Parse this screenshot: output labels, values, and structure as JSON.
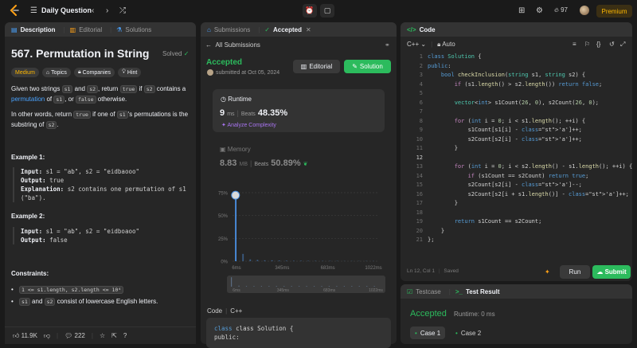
{
  "topnav": {
    "title": "Daily Question",
    "streak_count": "97",
    "premium_label": "Premium"
  },
  "left_panel": {
    "tabs": [
      {
        "label": "Description",
        "icon": "document-icon",
        "active": true
      },
      {
        "label": "Editorial",
        "icon": "book-icon",
        "active": false
      },
      {
        "label": "Solutions",
        "icon": "flask-icon",
        "active": false
      }
    ],
    "title": "567. Permutation in String",
    "solved_label": "Solved",
    "tags": [
      {
        "label": "Medium"
      },
      {
        "label": "Topics"
      },
      {
        "label": "Companies"
      },
      {
        "label": "Hint"
      }
    ],
    "desc": {
      "p1_a": "Given two strings ",
      "p1_s1": "s1",
      "p1_b": " and ",
      "p1_s2": "s2",
      "p1_c": ", return ",
      "p1_true": "true",
      "p1_d": " if ",
      "p1_s2b": "s2",
      "p1_e": " contains a ",
      "p1_link": "permutation",
      "p1_f": " of ",
      "p1_s1b": "s1",
      "p1_g": ", or ",
      "p1_false": "false",
      "p1_h": " otherwise.",
      "p2_a": "In other words, return ",
      "p2_true": "true",
      "p2_b": " if one of ",
      "p2_s1": "s1",
      "p2_c": "'s permutations is the substring of ",
      "p2_s2": "s2",
      "p2_d": "."
    },
    "examples": [
      {
        "title": "Example 1:",
        "input": "s1 = \"ab\", s2 = \"eidbaooo\"",
        "output": "true",
        "explanation": "s2 contains one permutation of s1 (\"ba\")."
      },
      {
        "title": "Example 2:",
        "input": "s1 = \"ab\", s2 = \"eidboaoo\"",
        "output": "false"
      }
    ],
    "labels": {
      "input": "Input:",
      "output": "Output:",
      "explanation": "Explanation:"
    },
    "constraints_title": "Constraints:",
    "constraints": {
      "c1": "1 <= s1.length, s2.length <= 10⁴",
      "c2_s1": "s1",
      "c2_and": " and ",
      "c2_s2": "s2",
      "c2_rest": " consist of lowercase English letters."
    },
    "footer": {
      "likes": "11.9K",
      "comments": "222"
    }
  },
  "middle_panel": {
    "tabs": [
      {
        "label": "Submissions",
        "icon": "tag-icon",
        "active": false
      },
      {
        "label": "Accepted",
        "icon": "check-icon",
        "active": true
      }
    ],
    "back_label": "All Submissions",
    "status": "Accepted",
    "submitted_at": "submitted at Oct 05, 2024",
    "editorial_btn": "Editorial",
    "solution_btn": "Solution",
    "runtime": {
      "label": "Runtime",
      "value": "9",
      "unit": "ms",
      "beats_label": "Beats",
      "beats": "48.35%",
      "analyze": "Analyze Complexity"
    },
    "memory": {
      "label": "Memory",
      "value": "8.83",
      "unit": "MB",
      "beats_label": "Beats",
      "beats": "50.89%"
    },
    "code_label": "Code",
    "code_lang": "C++",
    "code_preview": [
      "class Solution {",
      "public:"
    ]
  },
  "chart_data": {
    "type": "bar",
    "y_ticks": [
      "75%",
      "50%",
      "25%",
      "0%"
    ],
    "x_ticks": [
      "6ms",
      "345ms",
      "683ms",
      "1022ms"
    ],
    "minimap_ticks": [
      "6ms",
      "345ms",
      "683ms",
      "1022ms"
    ],
    "ylim": [
      0,
      75
    ],
    "series": [
      {
        "values": [
          74,
          8,
          2,
          1.5,
          1,
          1,
          0.8,
          0.6,
          0.5,
          0.5,
          0.4,
          0.4,
          0.3,
          0.3,
          0.3,
          0.2,
          0.2,
          0.2,
          0.2,
          0.2
        ]
      }
    ],
    "highlight_index": 0,
    "accent_color": "#4a90e2"
  },
  "right_panel": {
    "tab": "Code",
    "language": "C++",
    "autosave": "Auto",
    "cursor": "Ln 12, Col 1",
    "saved": "Saved",
    "run_btn": "Run",
    "submit_btn": "Submit",
    "code_lines": [
      "class Solution {",
      "public:",
      "    bool checkInclusion(string s1, string s2) {",
      "        if (s1.length() > s2.length()) return false;",
      "",
      "        vector<int> s1Count(26, 0), s2Count(26, 0);",
      "",
      "        for (int i = 0; i < s1.length(); ++i) {",
      "            s1Count[s1[i] - 'a']++;",
      "            s2Count[s2[i] - 'a']++;",
      "        }",
      "",
      "        for (int i = 0; i < s2.length() - s1.length(); ++i) {",
      "            if (s1Count == s2Count) return true;",
      "            s2Count[s2[i] - 'a']--;",
      "            s2Count[s2[i + s1.length()] - 'a']++;",
      "        }",
      "",
      "        return s1Count == s2Count;",
      "    }",
      "};"
    ],
    "current_line": 12
  },
  "bottom_right_panel": {
    "tabs": [
      {
        "label": "Testcase",
        "icon": "checkbox-icon",
        "active": false
      },
      {
        "label": "Test Result",
        "icon": "terminal-icon",
        "active": true
      }
    ],
    "status": "Accepted",
    "runtime": "Runtime: 0 ms",
    "cases": [
      {
        "label": "Case 1",
        "active": true
      },
      {
        "label": "Case 2",
        "active": false
      }
    ]
  }
}
